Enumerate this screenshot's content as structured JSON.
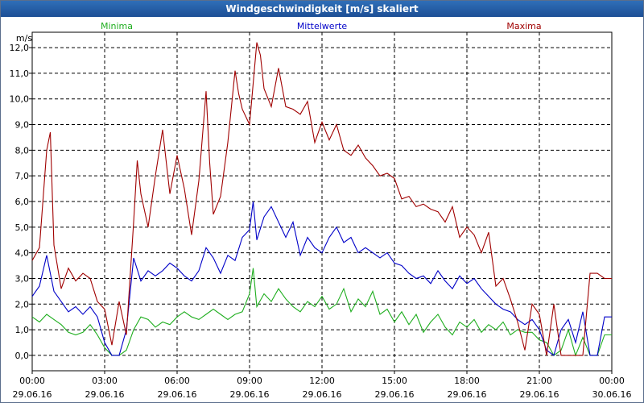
{
  "window": {
    "title": "Windgeschwindigkeit [m/s] skaliert"
  },
  "colors": {
    "minima": "#1fae1f",
    "mittelwerte": "#0000c8",
    "maxima": "#a00000",
    "grid": "#000000",
    "background": "#ffffff",
    "titlebar": "#2760a8"
  },
  "chart_data": {
    "type": "line",
    "title": "Windgeschwindigkeit [m/s] skaliert",
    "ylabel": "m/s",
    "ylim": [
      -0.6,
      12.6
    ],
    "yticks": [
      "12,0",
      "11,0",
      "10,0",
      "9,0",
      "8,0",
      "7,0",
      "6,0",
      "5,0",
      "4,0",
      "3,0",
      "2,0",
      "1,0",
      "0,0"
    ],
    "xticks": [
      {
        "time": "00:00",
        "date": "29.06.16"
      },
      {
        "time": "03:00",
        "date": "29.06.16"
      },
      {
        "time": "06:00",
        "date": "29.06.16"
      },
      {
        "time": "09:00",
        "date": "29.06.16"
      },
      {
        "time": "12:00",
        "date": "29.06.16"
      },
      {
        "time": "15:00",
        "date": "29.06.16"
      },
      {
        "time": "18:00",
        "date": "29.06.16"
      },
      {
        "time": "21:00",
        "date": "29.06.16"
      },
      {
        "time": "00:00",
        "date": "30.06.16"
      }
    ],
    "grid": true,
    "x_unit": "hours since 29.06.16 00:00",
    "series": [
      {
        "name": "Minima",
        "color": "#1fae1f",
        "x": [
          0,
          0.3,
          0.6,
          0.9,
          1.2,
          1.5,
          1.8,
          2.1,
          2.4,
          2.7,
          3.0,
          3.3,
          3.6,
          3.9,
          4.2,
          4.5,
          4.8,
          5.1,
          5.4,
          5.7,
          6.0,
          6.3,
          6.6,
          6.9,
          7.2,
          7.5,
          7.8,
          8.1,
          8.4,
          8.7,
          9.0,
          9.15,
          9.3,
          9.6,
          9.9,
          10.2,
          10.5,
          10.8,
          11.1,
          11.4,
          11.7,
          12.0,
          12.3,
          12.6,
          12.9,
          13.2,
          13.5,
          13.8,
          14.1,
          14.4,
          14.7,
          15.0,
          15.3,
          15.6,
          15.9,
          16.2,
          16.5,
          16.8,
          17.1,
          17.4,
          17.7,
          18.0,
          18.3,
          18.6,
          18.9,
          19.2,
          19.5,
          19.8,
          20.1,
          20.4,
          20.7,
          21.0,
          21.3,
          21.6,
          21.9,
          22.2,
          22.5,
          22.8,
          23.1,
          23.4,
          23.7,
          24.0
        ],
        "y": [
          1.5,
          1.3,
          1.6,
          1.4,
          1.2,
          0.9,
          0.8,
          0.9,
          1.2,
          0.8,
          0.3,
          0.0,
          0.0,
          0.2,
          1.0,
          1.5,
          1.4,
          1.1,
          1.3,
          1.2,
          1.5,
          1.7,
          1.5,
          1.4,
          1.6,
          1.8,
          1.6,
          1.4,
          1.6,
          1.7,
          2.4,
          3.4,
          1.9,
          2.4,
          2.1,
          2.6,
          2.2,
          1.9,
          1.7,
          2.1,
          1.9,
          2.3,
          1.8,
          2.0,
          2.6,
          1.7,
          2.2,
          1.9,
          2.5,
          1.6,
          1.8,
          1.3,
          1.7,
          1.2,
          1.6,
          0.9,
          1.3,
          1.6,
          1.1,
          0.8,
          1.3,
          1.1,
          1.4,
          0.9,
          1.2,
          1.0,
          1.3,
          0.8,
          1.0,
          0.9,
          0.9,
          0.6,
          0.5,
          0.0,
          0.2,
          1.0,
          0.0,
          0.7,
          0.0,
          0.0,
          0.8,
          0.8
        ]
      },
      {
        "name": "Mittelwerte",
        "color": "#0000c8",
        "x": [
          0,
          0.3,
          0.6,
          0.9,
          1.2,
          1.5,
          1.8,
          2.1,
          2.4,
          2.7,
          3.0,
          3.3,
          3.6,
          3.9,
          4.2,
          4.5,
          4.8,
          5.1,
          5.4,
          5.7,
          6.0,
          6.3,
          6.6,
          6.9,
          7.2,
          7.5,
          7.8,
          8.1,
          8.4,
          8.7,
          9.0,
          9.15,
          9.3,
          9.6,
          9.9,
          10.2,
          10.5,
          10.8,
          11.1,
          11.4,
          11.7,
          12.0,
          12.3,
          12.6,
          12.9,
          13.2,
          13.5,
          13.8,
          14.1,
          14.4,
          14.7,
          15.0,
          15.3,
          15.6,
          15.9,
          16.2,
          16.5,
          16.8,
          17.1,
          17.4,
          17.7,
          18.0,
          18.3,
          18.6,
          18.9,
          19.2,
          19.5,
          19.8,
          20.1,
          20.4,
          20.7,
          21.0,
          21.3,
          21.6,
          21.9,
          22.2,
          22.5,
          22.8,
          23.1,
          23.4,
          23.7,
          24.0
        ],
        "y": [
          2.3,
          2.7,
          3.9,
          2.5,
          2.1,
          1.7,
          1.9,
          1.6,
          1.9,
          1.5,
          0.5,
          0.0,
          0.0,
          1.0,
          3.8,
          2.9,
          3.3,
          3.1,
          3.3,
          3.6,
          3.4,
          3.1,
          2.9,
          3.3,
          4.2,
          3.8,
          3.2,
          3.9,
          3.7,
          4.6,
          4.9,
          6.0,
          4.5,
          5.4,
          5.8,
          5.2,
          4.6,
          5.2,
          3.9,
          4.6,
          4.2,
          4.0,
          4.6,
          5.0,
          4.4,
          4.6,
          4.0,
          4.2,
          4.0,
          3.8,
          4.0,
          3.6,
          3.5,
          3.2,
          3.0,
          3.1,
          2.8,
          3.3,
          2.9,
          2.6,
          3.1,
          2.8,
          3.0,
          2.6,
          2.3,
          2.0,
          1.8,
          1.7,
          1.4,
          1.2,
          1.4,
          1.0,
          0.2,
          0.0,
          1.0,
          1.4,
          0.5,
          1.7,
          0.0,
          0.0,
          1.5,
          1.5
        ]
      },
      {
        "name": "Maxima",
        "color": "#a00000",
        "x": [
          0,
          0.3,
          0.6,
          0.75,
          0.9,
          1.2,
          1.5,
          1.8,
          2.1,
          2.4,
          2.7,
          3.0,
          3.3,
          3.6,
          3.9,
          4.2,
          4.35,
          4.5,
          4.8,
          5.1,
          5.4,
          5.7,
          6.0,
          6.3,
          6.6,
          6.9,
          7.2,
          7.35,
          7.5,
          7.8,
          8.1,
          8.4,
          8.55,
          8.7,
          9.0,
          9.3,
          9.45,
          9.6,
          9.9,
          10.2,
          10.5,
          10.8,
          11.1,
          11.4,
          11.7,
          12.0,
          12.3,
          12.6,
          12.9,
          13.2,
          13.5,
          13.8,
          14.1,
          14.4,
          14.7,
          15.0,
          15.3,
          15.6,
          15.9,
          16.2,
          16.5,
          16.8,
          17.1,
          17.4,
          17.7,
          18.0,
          18.3,
          18.6,
          18.9,
          19.2,
          19.5,
          19.8,
          20.1,
          20.4,
          20.7,
          21.0,
          21.3,
          21.6,
          21.9,
          22.2,
          22.5,
          22.8,
          23.1,
          23.4,
          23.7,
          24.0
        ],
        "y": [
          3.7,
          4.2,
          8.0,
          8.7,
          4.3,
          2.6,
          3.4,
          2.9,
          3.2,
          3.0,
          2.1,
          1.8,
          0.4,
          2.1,
          0.8,
          5.2,
          7.6,
          6.3,
          5.0,
          7.0,
          8.8,
          6.3,
          7.8,
          6.5,
          4.7,
          6.8,
          10.3,
          7.5,
          5.5,
          6.2,
          8.3,
          11.1,
          10.2,
          9.6,
          9.0,
          12.2,
          11.7,
          10.4,
          9.7,
          11.2,
          9.7,
          9.6,
          9.4,
          9.9,
          8.3,
          9.1,
          8.4,
          9.0,
          8.0,
          7.8,
          8.2,
          7.7,
          7.4,
          7.0,
          7.1,
          6.9,
          6.1,
          6.2,
          5.8,
          5.9,
          5.7,
          5.6,
          5.2,
          5.8,
          4.6,
          5.0,
          4.7,
          4.0,
          4.8,
          2.7,
          3.0,
          2.2,
          1.3,
          0.2,
          2.0,
          1.6,
          0.0,
          2.0,
          0.0,
          0.0,
          0.0,
          0.0,
          3.2,
          3.2,
          3.0,
          3.0
        ]
      }
    ]
  }
}
